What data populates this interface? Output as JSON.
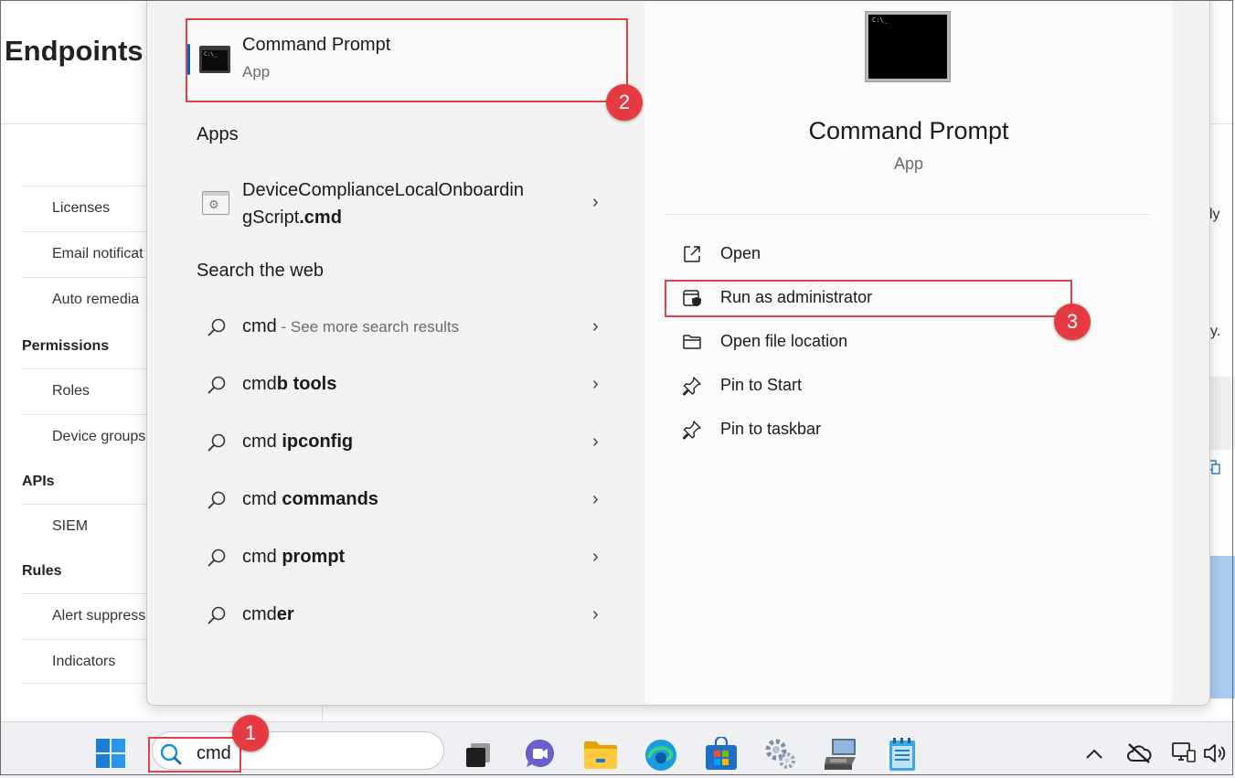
{
  "background": {
    "page_title": "Endpoints",
    "nav": {
      "items_top": [
        "Licenses",
        "Email notificat",
        "Auto remedia"
      ],
      "permissions_header": "Permissions",
      "permissions_items": [
        "Roles",
        "Device groups"
      ],
      "apis_header": "APIs",
      "apis_items": [
        "SIEM"
      ],
      "rules_header": "Rules",
      "rules_items": [
        "Alert suppress",
        "Indicators"
      ]
    },
    "right_fragments": [
      "ly",
      "y."
    ]
  },
  "start_menu": {
    "best_match": {
      "title": "Command Prompt",
      "subtitle": "App",
      "icon": "cmd-icon"
    },
    "apps_header": "Apps",
    "apps": [
      {
        "line1": "DeviceComplianceLocalOnboardin",
        "line2_plain": "gScript",
        "line2_bold": ".cmd",
        "icon": "script-icon"
      }
    ],
    "web_header": "Search the web",
    "web_results": [
      {
        "plain": "cmd",
        "bold": "",
        "dim": " - See more search results"
      },
      {
        "plain": "cmd",
        "bold": "b tools",
        "dim": ""
      },
      {
        "plain": "cmd ",
        "bold": "ipconfig",
        "dim": ""
      },
      {
        "plain": "cmd ",
        "bold": "commands",
        "dim": ""
      },
      {
        "plain": "cmd ",
        "bold": "prompt",
        "dim": ""
      },
      {
        "plain": "cmd",
        "bold": "er",
        "dim": ""
      }
    ],
    "details": {
      "title": "Command Prompt",
      "subtitle": "App",
      "actions": [
        {
          "label": "Open",
          "icon": "open-external-icon"
        },
        {
          "label": "Run as administrator",
          "icon": "shield-admin-icon"
        },
        {
          "label": "Open file location",
          "icon": "folder-icon"
        },
        {
          "label": "Pin to Start",
          "icon": "pin-icon"
        },
        {
          "label": "Pin to taskbar",
          "icon": "pin-icon"
        }
      ]
    }
  },
  "taskbar": {
    "search_value": "cmd",
    "apps": [
      "windows-start-icon",
      "task-view-icon",
      "teams-chat-icon",
      "file-explorer-icon",
      "edge-icon",
      "store-icon",
      "settings-icon",
      "remote-desktop-icon",
      "notepad-icon"
    ],
    "tray": [
      "chevron-up-icon",
      "onedrive-offline-icon",
      "network-icon",
      "volume-icon"
    ]
  },
  "annotations": {
    "step1": "1",
    "step2": "2",
    "step3": "3",
    "color": "#e53a3f"
  }
}
